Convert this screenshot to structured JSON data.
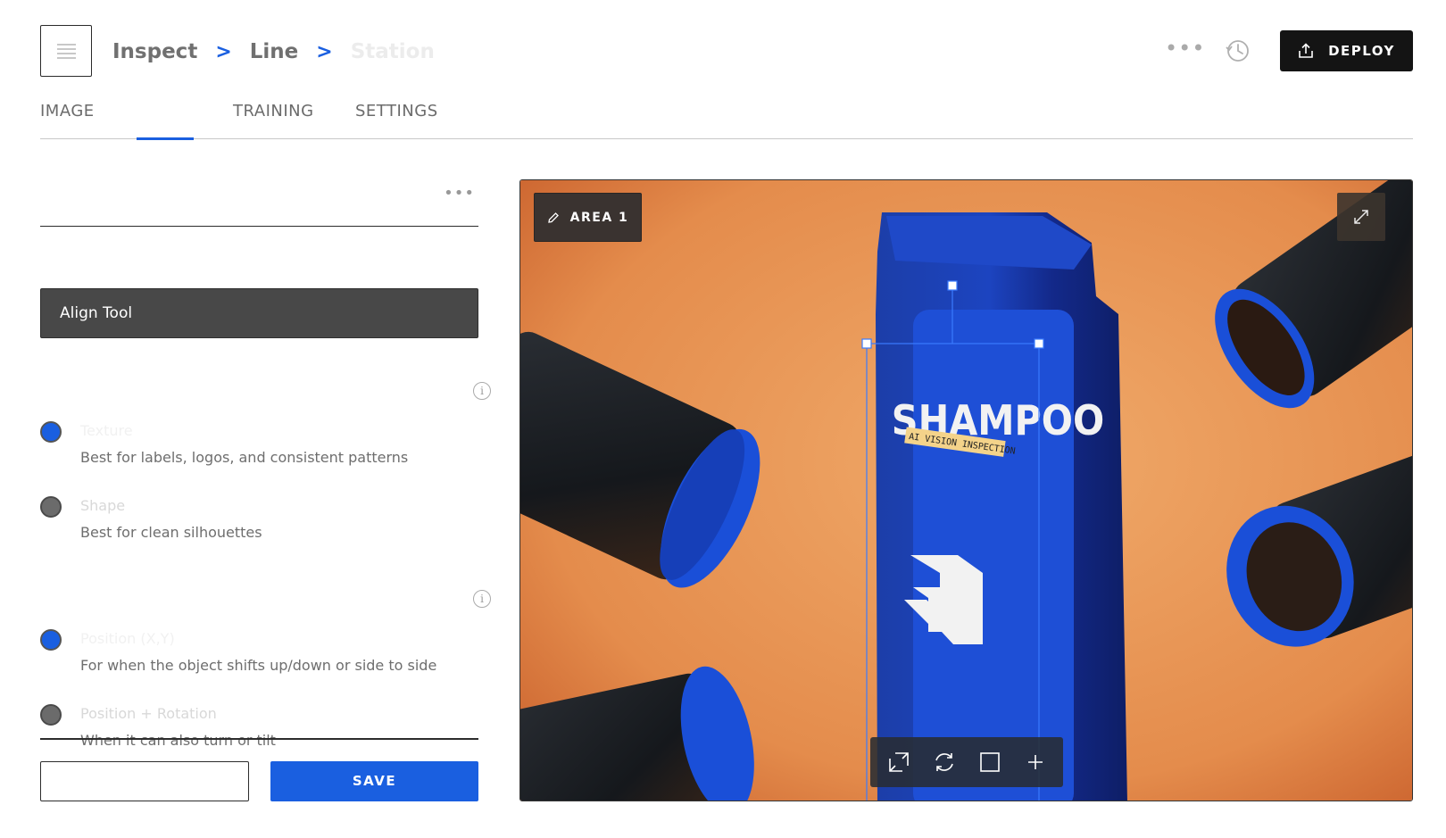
{
  "header": {
    "breadcrumb": [
      "Inspect",
      "Line",
      "Station"
    ],
    "deploy_label": "DEPLOY"
  },
  "tabs": [
    {
      "label": "IMAGE"
    },
    {
      "label": ""
    },
    {
      "label": "TRAINING"
    },
    {
      "label": "SETTINGS"
    }
  ],
  "active_tab_index": 1,
  "panel": {
    "title": "",
    "subtitle": "",
    "tool_label": "Align Tool",
    "section1": {
      "title": "",
      "options": [
        {
          "label": "Texture",
          "desc": "Best for labels, logos, and consistent patterns",
          "selected": true
        },
        {
          "label": "Shape",
          "desc": "Best for clean silhouettes",
          "selected": false
        }
      ]
    },
    "section2": {
      "title": "",
      "options": [
        {
          "label": "Position (X,Y)",
          "desc": "For when the object shifts up/down or side to side",
          "selected": true
        },
        {
          "label": "Position + Rotation",
          "desc": "When it can also turn or tilt",
          "selected": false
        }
      ]
    },
    "cancel_label": "",
    "save_label": "SAVE"
  },
  "viewer": {
    "area_label": "AREA 1",
    "bottle_text": "SHAMPOO",
    "label_strip_text": "AI VISION INSPECTION",
    "toolbar_icons": [
      "resize-icon",
      "rotate-icon",
      "square-icon",
      "plus-icon"
    ]
  },
  "colors": {
    "accent": "#1a5fe0",
    "background_orange": "#e8a060",
    "bottle_blue": "#1a4fd0",
    "dark_button": "#141414"
  }
}
